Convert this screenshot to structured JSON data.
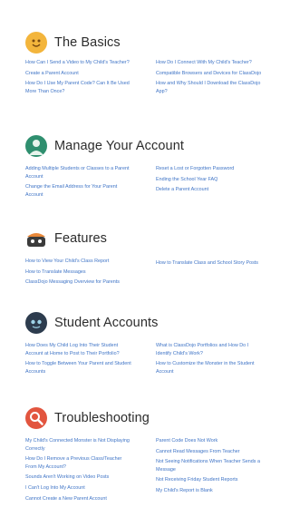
{
  "sections": [
    {
      "title": "The Basics",
      "icon": "basics-face-icon",
      "icon_color": "#f3b53c",
      "left": [
        "How Can I Send a Video to My Child's Teacher?",
        "Create a Parent Account",
        "How Do I Use My Parent Code? Can It Be Used More Than Once?"
      ],
      "right": [
        "How Do I Connect With My Child's Teacher?",
        "Compatible Browsers and Devices for ClassDojo",
        "How and Why Should I Download the ClassDojo App?"
      ]
    },
    {
      "title": "Manage Your Account",
      "icon": "account-person-icon",
      "icon_color": "#2f8f6f",
      "left": [
        "Adding Multiple Students or Classes to a Parent Account",
        "Change the Email Address for Your Parent Account"
      ],
      "right": [
        "Reset a Lost or Forgotten Password",
        "Ending the School Year FAQ",
        "Delete a Parent Account"
      ]
    },
    {
      "title": "Features",
      "icon": "features-monster-icon",
      "icon_color": "#4a4a4a",
      "left": [
        "How to View Your Child's Class Report",
        "How to Translate Messages",
        "ClassDojo Messaging Overview for Parents"
      ],
      "right": [
        "How to Translate Class and School Story Posts"
      ]
    },
    {
      "title": "Student Accounts",
      "icon": "student-monster-icon",
      "icon_color": "#2d3c4e",
      "left": [
        "How Does My Child Log Into Their Student Account at Home to Post to Their Portfolio?",
        "How to Toggle Between Your Parent and Student Accounts"
      ],
      "right": [
        "What is ClassDojo Portfolios and How Do I Identify Child's Work?",
        "How to Customize the Monster in the Student Account"
      ]
    },
    {
      "title": "Troubleshooting",
      "icon": "magnifier-icon",
      "icon_color": "#e2553f",
      "left": [
        "My Child's Connected Monster is Not Displaying Correctly",
        "How Do I Remove a Previous Class/Teacher From My Account?",
        "Sounds Aren't Working on Video Posts",
        "I Can't Log Into My Account",
        "Cannot Create a New Parent Account"
      ],
      "right": [
        "Parent Code Does Not Work",
        "Cannot Read Messages From Teacher",
        "Not Seeing Notifications When Teacher Sends a Message",
        "Not Receiving Friday Student Reports",
        "My Child's Report is Blank"
      ]
    }
  ],
  "colors": {
    "link": "#3f74c6",
    "heading": "#2c2c2c"
  }
}
